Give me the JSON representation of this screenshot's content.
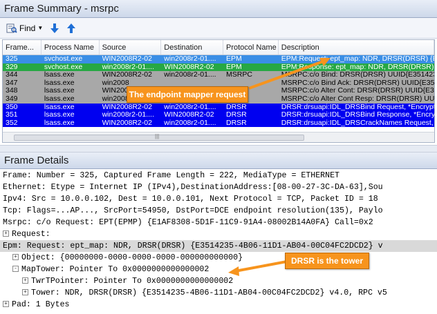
{
  "frame_summary": {
    "title": "Frame Summary - msrpc",
    "toolbar": {
      "find_label": "Find"
    },
    "columns": [
      "Frame...",
      "Process Name",
      "Source",
      "Destination",
      "Protocol Name",
      "Description"
    ],
    "rows": [
      {
        "style": "sel",
        "cells": [
          "325",
          "svchost.exe",
          "WIN2008R2-02",
          "win2008r2-01....",
          "EPM",
          "EPM:Request: ept_map: NDR, DRSR(DRSR) {E3"
        ]
      },
      {
        "style": "grn",
        "cells": [
          "329",
          "svchost.exe",
          "win2008r2-01....",
          "WIN2008R2-02",
          "EPM",
          "EPM:Response: ept_map: NDR, DRSR(DRSR) {E"
        ]
      },
      {
        "style": "gry",
        "cells": [
          "344",
          "lsass.exe",
          "WIN2008R2-02",
          "win2008r2-01....",
          "MSRPC",
          "MSRPC:c/o Bind: DRSR(DRSR) UUID{E3514235"
        ]
      },
      {
        "style": "gry",
        "cells": [
          "347",
          "lsass.exe",
          "win2008",
          "",
          "",
          "MSRPC:c/o Bind Ack: DRSR(DRSR) UUID{E3514"
        ]
      },
      {
        "style": "gry",
        "cells": [
          "348",
          "lsass.exe",
          "WIN2008",
          "",
          "",
          "MSRPC:c/o Alter Cont: DRSR(DRSR)  UUID{E35"
        ]
      },
      {
        "style": "gry",
        "cells": [
          "349",
          "lsass.exe",
          "win2008",
          "",
          "",
          "MSRPC:c/o Alter Cont Resp: DRSR(DRSR) UUI"
        ]
      },
      {
        "style": "blu",
        "cells": [
          "350",
          "lsass.exe",
          "WIN2008R2-02",
          "win2008r2-01....",
          "DRSR",
          "DRSR:drsuapi:IDL_DRSBind Request, *Encrypte"
        ]
      },
      {
        "style": "blu",
        "cells": [
          "351",
          "lsass.exe",
          "win2008r2-01....",
          "WIN2008R2-02",
          "DRSR",
          "DRSR:drsuapi:IDL_DRSBind Response, *Encryp"
        ]
      },
      {
        "style": "blu",
        "cells": [
          "352",
          "lsass.exe",
          "WIN2008R2-02",
          "win2008r2-01....",
          "DRSR",
          "DRSR:drsuapi:IDL_DRSCrackNames Request, *E"
        ]
      }
    ]
  },
  "frame_details": {
    "title": "Frame Details",
    "lines": [
      {
        "toggle": "",
        "text": "Frame: Number = 325, Captured Frame Length = 222, MediaType = ETHERNET"
      },
      {
        "toggle": "",
        "text": "Ethernet: Etype = Internet IP (IPv4),DestinationAddress:[08-00-27-3C-DA-63],Sou"
      },
      {
        "toggle": "",
        "text": "Ipv4: Src = 10.0.0.102, Dest = 10.0.0.101, Next Protocol = TCP, Packet ID = 18"
      },
      {
        "toggle": "",
        "text": "Tcp: Flags=...AP..., SrcPort=54950, DstPort=DCE endpoint resolution(135), Paylo"
      },
      {
        "toggle": "",
        "text": "Msrpc: c/o Request: EPT(EPMP) {E1AF8308-5D1F-11C9-91A4-08002B14A0FA}  Call=0x2"
      },
      {
        "toggle": "+",
        "text": "Request:"
      },
      {
        "toggle": "",
        "text": "Epm: Request: ept_map: NDR, DRSR(DRSR) {E3514235-4B06-11D1-AB04-00C04FC2DCD2} v"
      },
      {
        "toggle": "+",
        "text": "Object: {00000000-0000-0000-0000-000000000000}"
      },
      {
        "toggle": "-",
        "text": "MapTower: Pointer To 0x0000000000000002"
      },
      {
        "toggle": "+",
        "text": "TwrTPointer: Pointer To 0x0000000000000002"
      },
      {
        "toggle": "+",
        "text": "Tower: NDR, DRSR(DRSR) {E3514235-4B06-11D1-AB04-00C04FC2DCD2} v4.0, RPC v5"
      },
      {
        "toggle": "+",
        "text": "Pad: 1 Bytes"
      }
    ]
  },
  "callouts": {
    "endpoint": "The endpoint mapper request",
    "tower": "DRSR is the tower"
  },
  "colors": {
    "selected": "#3a8ee6",
    "green": "#27a844",
    "gray": "#a8a8a8",
    "blue": "#0000f0",
    "callout": "#f7941d"
  }
}
